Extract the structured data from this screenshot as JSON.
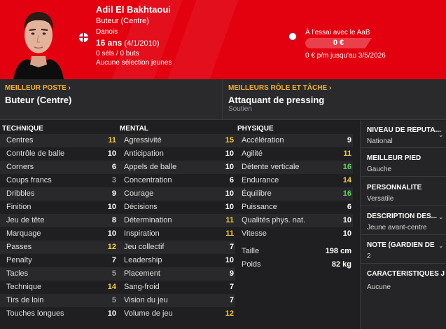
{
  "header": {
    "name": "Adil El Bakhtaoui",
    "role": "Buteur (Centre)",
    "nationality": "Danois",
    "age": "16 ans",
    "birth": "(4/1/2010)",
    "caps": "0 séls / 0 buts",
    "youth": "Aucune sélection jeunes",
    "trial": "À l'essai avec le AaB",
    "fee": "0 €",
    "wage": "0 € p/m jusqu'au 3/5/2026",
    "accent": "#e3000f"
  },
  "position": {
    "best_position_caption": "MEILLEUR POSTE",
    "best_position": "Buteur (Centre)",
    "best_role_caption": "MEILLEURS RÔLE ET TÂCHE",
    "best_role": "Attaquant de pressing",
    "best_duty": "Soutien"
  },
  "technique": {
    "title": "TECHNIQUE",
    "items": [
      {
        "label": "Centres",
        "value": "11"
      },
      {
        "label": "Contrôle de balle",
        "value": "10"
      },
      {
        "label": "Corners",
        "value": "6"
      },
      {
        "label": "Coups francs",
        "value": "3"
      },
      {
        "label": "Dribbles",
        "value": "9"
      },
      {
        "label": "Finition",
        "value": "10"
      },
      {
        "label": "Jeu de tête",
        "value": "8"
      },
      {
        "label": "Marquage",
        "value": "10"
      },
      {
        "label": "Passes",
        "value": "12"
      },
      {
        "label": "Penalty",
        "value": "7"
      },
      {
        "label": "Tacles",
        "value": "5"
      },
      {
        "label": "Technique",
        "value": "14"
      },
      {
        "label": "Tirs de loin",
        "value": "5"
      },
      {
        "label": "Touches longues",
        "value": "10"
      }
    ]
  },
  "mental": {
    "title": "MENTAL",
    "items": [
      {
        "label": "Agressivité",
        "value": "15"
      },
      {
        "label": "Anticipation",
        "value": "10"
      },
      {
        "label": "Appels de balle",
        "value": "10"
      },
      {
        "label": "Concentration",
        "value": "6"
      },
      {
        "label": "Courage",
        "value": "10"
      },
      {
        "label": "Décisions",
        "value": "10"
      },
      {
        "label": "Détermination",
        "value": "11"
      },
      {
        "label": "Inspiration",
        "value": "11"
      },
      {
        "label": "Jeu collectif",
        "value": "7"
      },
      {
        "label": "Leadership",
        "value": "10"
      },
      {
        "label": "Placement",
        "value": "9"
      },
      {
        "label": "Sang-froid",
        "value": "7"
      },
      {
        "label": "Vision du jeu",
        "value": "7"
      },
      {
        "label": "Volume de jeu",
        "value": "12"
      }
    ]
  },
  "physique": {
    "title": "PHYSIQUE",
    "items": [
      {
        "label": "Accélération",
        "value": "9"
      },
      {
        "label": "Agilité",
        "value": "11"
      },
      {
        "label": "Détente verticale",
        "value": "16"
      },
      {
        "label": "Endurance",
        "value": "14"
      },
      {
        "label": "Équilibre",
        "value": "16"
      },
      {
        "label": "Puissance",
        "value": "6"
      },
      {
        "label": "Qualités phys. nat.",
        "value": "10"
      },
      {
        "label": "Vitesse",
        "value": "10"
      }
    ],
    "height_label": "Taille",
    "height": "198 cm",
    "weight_label": "Poids",
    "weight": "82 kg"
  },
  "sidebar": {
    "reputation_title": "NIVEAU DE RÉPUTA...",
    "reputation": "National",
    "foot_title": "MEILLEUR PIED",
    "foot": "Gauche",
    "personality_title": "PERSONNALITÉ",
    "personality": "Versatile",
    "description_title": "DESCRIPTION DES...",
    "description": "Jeune avant-centre",
    "gk_note_title": "NOTE (GARDIEN DE",
    "gk_note": "2",
    "traits_title": "CARACTÉRISTIQUES J",
    "traits": "Aucune"
  }
}
